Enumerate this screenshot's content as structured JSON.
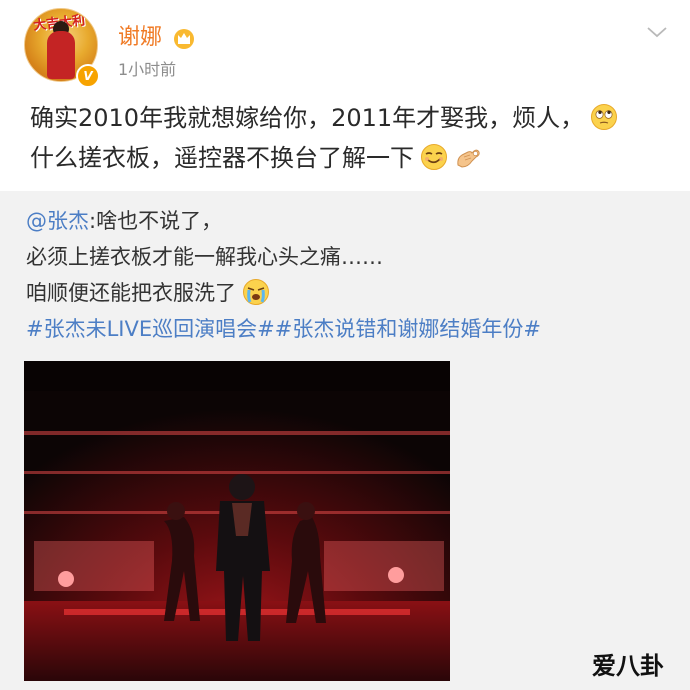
{
  "author": {
    "name": "谢娜",
    "time": "1小时前",
    "avatar_badge_text": "大吉大利",
    "verified_mark": "V"
  },
  "post": {
    "lines": [
      "确实2010年我就想嫁给你，2011年才娶我，烦人，",
      "什么搓衣板，遥控器不换台了解一下"
    ]
  },
  "retweet": {
    "mention": "@张杰",
    "line1_rest": ":啥也不说了，",
    "line2": "必须上搓衣板才能一解我心头之痛……",
    "line3": "咱顺便还能把衣服洗了",
    "hashtags": "#张杰未LIVE巡回演唱会##张杰说错和谢娜结婚年份#"
  },
  "watermark": {
    "text": "爱八卦"
  },
  "colors": {
    "username": "#f07b26",
    "link": "#4c7ec5",
    "retweet_bg": "#f2f2f2",
    "verified": "#f7a300"
  },
  "icons": {
    "crown": "crown-icon",
    "chevron": "chevron-down-icon",
    "eye_roll": "eye-roll-emoji-icon",
    "smirk": "smirk-emoji-icon",
    "ok_hand": "ok-hand-emoji-icon",
    "crying": "crying-emoji-icon"
  }
}
